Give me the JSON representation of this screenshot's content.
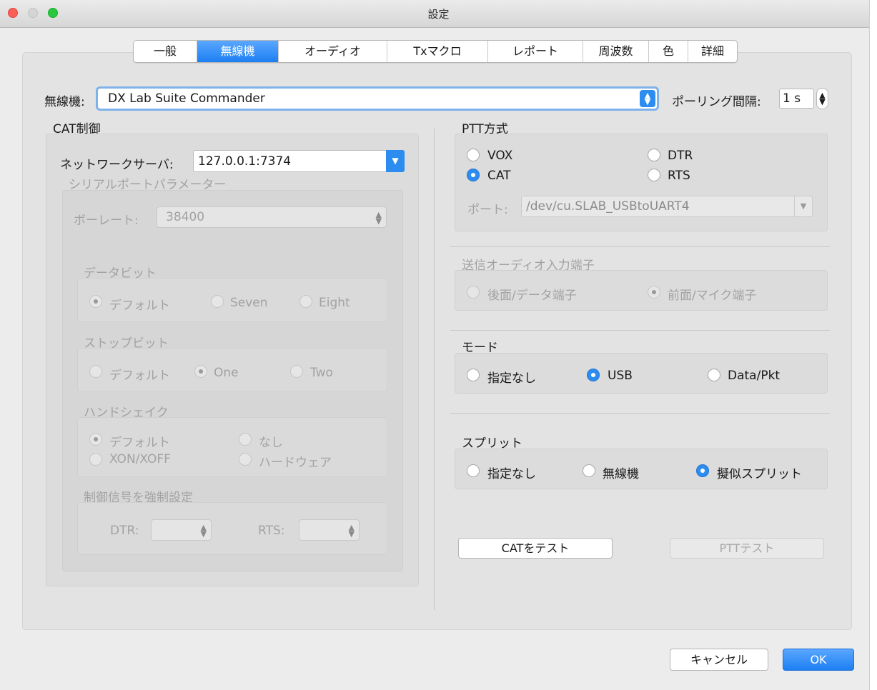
{
  "window": {
    "title": "設定"
  },
  "tabs": [
    "一般",
    "無線機",
    "オーディオ",
    "Txマクロ",
    "レポート",
    "周波数",
    "色",
    "詳細"
  ],
  "radio": {
    "label": "無線機:",
    "value": "DX Lab Suite Commander"
  },
  "polling": {
    "label": "ポーリング間隔:",
    "value": "1 s"
  },
  "cat": {
    "title": "CAT制御",
    "network_label": "ネットワークサーバ:",
    "network_value": "127.0.0.1:7374",
    "serial_title": "シリアルポートパラメーター",
    "baud_label": "ボーレート:",
    "baud_value": "38400",
    "databits": {
      "title": "データビット",
      "options": [
        "デフォルト",
        "Seven",
        "Eight"
      ]
    },
    "stopbits": {
      "title": "ストップビット",
      "options": [
        "デフォルト",
        "One",
        "Two"
      ]
    },
    "handshake": {
      "title": "ハンドシェイク",
      "options": [
        "デフォルト",
        "なし",
        "XON/XOFF",
        "ハードウェア"
      ]
    },
    "force": {
      "title": "制御信号を強制設定",
      "dtr": "DTR:",
      "rts": "RTS:"
    }
  },
  "ptt": {
    "title": "PTT方式",
    "options": [
      "VOX",
      "DTR",
      "CAT",
      "RTS"
    ],
    "port_label": "ポート:",
    "port_value": "/dev/cu.SLAB_USBtoUART4"
  },
  "tx_audio": {
    "title": "送信オーディオ入力端子",
    "options": [
      "後面/データ端子",
      "前面/マイク端子"
    ]
  },
  "mode": {
    "title": "モード",
    "options": [
      "指定なし",
      "USB",
      "Data/Pkt"
    ]
  },
  "split": {
    "title": "スプリット",
    "options": [
      "指定なし",
      "無線機",
      "擬似スプリット"
    ]
  },
  "buttons": {
    "test_cat": "CATをテスト",
    "test_ptt": "PTTテスト",
    "cancel": "キャンセル",
    "ok": "OK"
  },
  "colors": {
    "accent": "#2d8cf0",
    "close": "#fc5f57",
    "minimize": "#d5d5d5",
    "zoom": "#29c840"
  }
}
